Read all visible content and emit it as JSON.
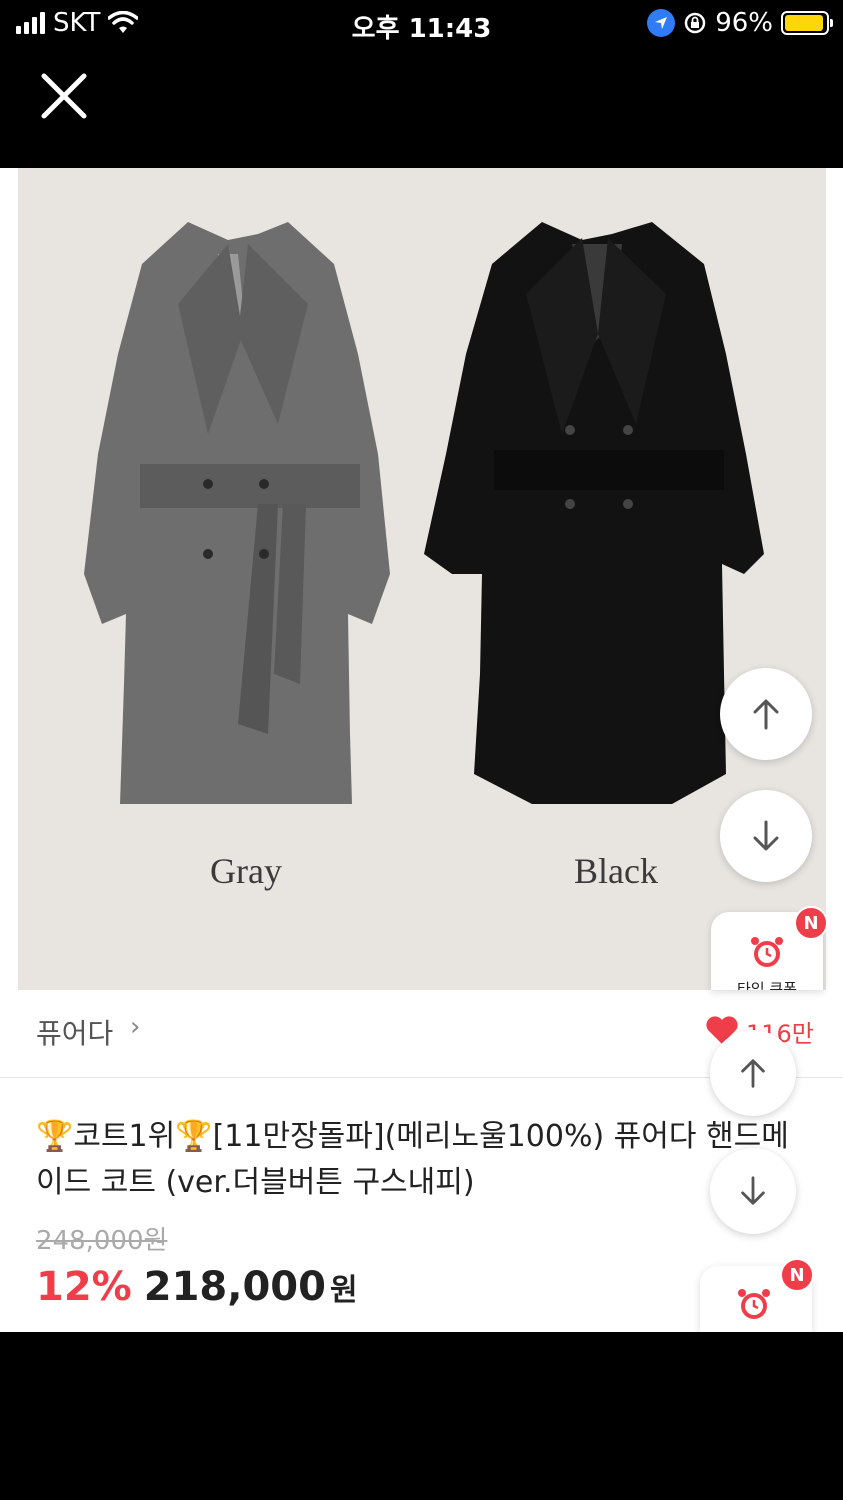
{
  "status_bar": {
    "carrier": "SKT",
    "time": "오후 11:43",
    "battery": "96%",
    "battery_level": 0.96
  },
  "icons": {
    "close": "close-icon",
    "arrow_up": "arrow-up-icon",
    "arrow_down": "arrow-down-icon",
    "alarm": "alarm-clock-icon",
    "heart": "heart-icon",
    "trophy": "trophy-icon"
  },
  "product_image": {
    "colors": [
      "Gray",
      "Black"
    ]
  },
  "coupon": {
    "label": "타임 쿠폰",
    "badge": "N"
  },
  "store": {
    "name": "퓨어다",
    "chevron": "›",
    "likes": "116만"
  },
  "product": {
    "title": "🏆코트1위🏆[11만장돌파](메리노울100%) 퓨어다 핸드메이드 코트 (ver.더블버튼 구스내피)",
    "original_price": "248,000원",
    "discount": "12%",
    "price": "218,000",
    "currency": "원"
  },
  "colors": {
    "accent": "#ef3e4a",
    "battery": "#ffd60a",
    "location": "#2f7cf6"
  }
}
